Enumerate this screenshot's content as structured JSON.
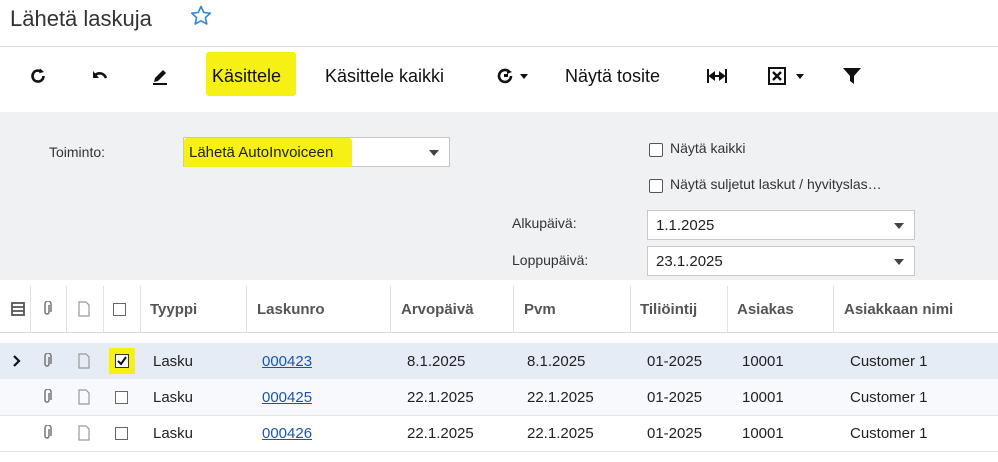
{
  "header": {
    "title": "Lähetä laskuja"
  },
  "toolbar": {
    "process": "Käsittele",
    "process_all": "Käsittele kaikki",
    "show_voucher": "Näytä tosite"
  },
  "filter": {
    "action_label": "Toiminto:",
    "action_value": "Lähetä AutoInvoiceen",
    "show_all": "Näytä kaikki",
    "show_closed": "Näytä suljetut laskut / hyvityslas…",
    "start_label": "Alkupäivä:",
    "start_value": "1.1.2025",
    "end_label": "Loppupäivä:",
    "end_value": "23.1.2025"
  },
  "table": {
    "columns": [
      "Tyyppi",
      "Laskunro",
      "Arvopäivä",
      "Pvm",
      "Tiliöintij",
      "Asiakas",
      "Asiakkaan nimi"
    ],
    "rows": [
      {
        "type": "Lasku",
        "number": "000423",
        "value_date": "8.1.2025",
        "date": "8.1.2025",
        "period": "01-2025",
        "customer": "10001",
        "name": "Customer 1",
        "checked": true
      },
      {
        "type": "Lasku",
        "number": "000425",
        "value_date": "22.1.2025",
        "date": "22.1.2025",
        "period": "01-2025",
        "customer": "10001",
        "name": "Customer 1",
        "checked": false
      },
      {
        "type": "Lasku",
        "number": "000426",
        "value_date": "22.1.2025",
        "date": "22.1.2025",
        "period": "01-2025",
        "customer": "10001",
        "name": "Customer 1",
        "checked": false
      }
    ]
  },
  "colors": {
    "highlight": "#f6f015",
    "link": "#1a56a8",
    "selected_row": "#e6ecf6"
  }
}
